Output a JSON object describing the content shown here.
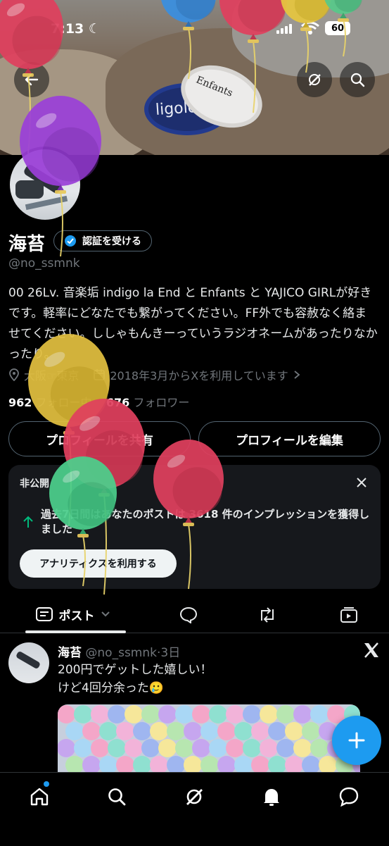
{
  "status_bar": {
    "time": "7:13",
    "battery": "60"
  },
  "banner": {
    "band1_text": "ligolo",
    "band2_text": "Enfants"
  },
  "profile": {
    "name": "海苔",
    "verify_label": "認証を受ける",
    "handle": "@no_ssmnk",
    "bio": "00 26Lv. 音楽垢 indigo la End と Enfants と YAJICO GIRLが好きです。軽率にどなたでも繋がってください。FF外でも容赦なく絡ませてください。ししゃもんきーっていうラジオネームがあったりなかったり。",
    "location": "大阪☞東京",
    "joined": "2018年3月からXを利用しています",
    "following_count": "962",
    "following_label": "フォロー中",
    "followers_count": "676",
    "followers_label": "フォロワー",
    "share_label": "プロフィールを共有",
    "edit_label": "プロフィールを編集"
  },
  "analytics_card": {
    "badge": "非公開",
    "message": "過去7日間はあなたのポストは 3618 件のインプレッションを獲得しました",
    "button": "アナリティクスを利用する"
  },
  "tabs": {
    "posts_label": "ポスト"
  },
  "tweet": {
    "name": "海苔",
    "meta": "@no_ssmnk·3日",
    "line1": "200円でゲットした嬉しい！",
    "line2": "けど4回分余った🥲"
  },
  "colors": {
    "accent": "#1d9bf0",
    "background": "#000000",
    "card": "#16181c",
    "muted": "#71767b"
  },
  "icons": [
    "back-arrow-icon",
    "grok-icon",
    "search-icon",
    "verified-badge-icon",
    "location-icon",
    "calendar-icon",
    "chevron-right-icon",
    "close-icon",
    "arrow-up-icon",
    "posts-tab-icon",
    "chevron-down-icon",
    "reply-tab-icon",
    "repost-tab-icon",
    "media-tab-icon",
    "x-logo-icon",
    "compose-plus-icon",
    "home-icon",
    "notifications-icon",
    "messages-icon"
  ]
}
